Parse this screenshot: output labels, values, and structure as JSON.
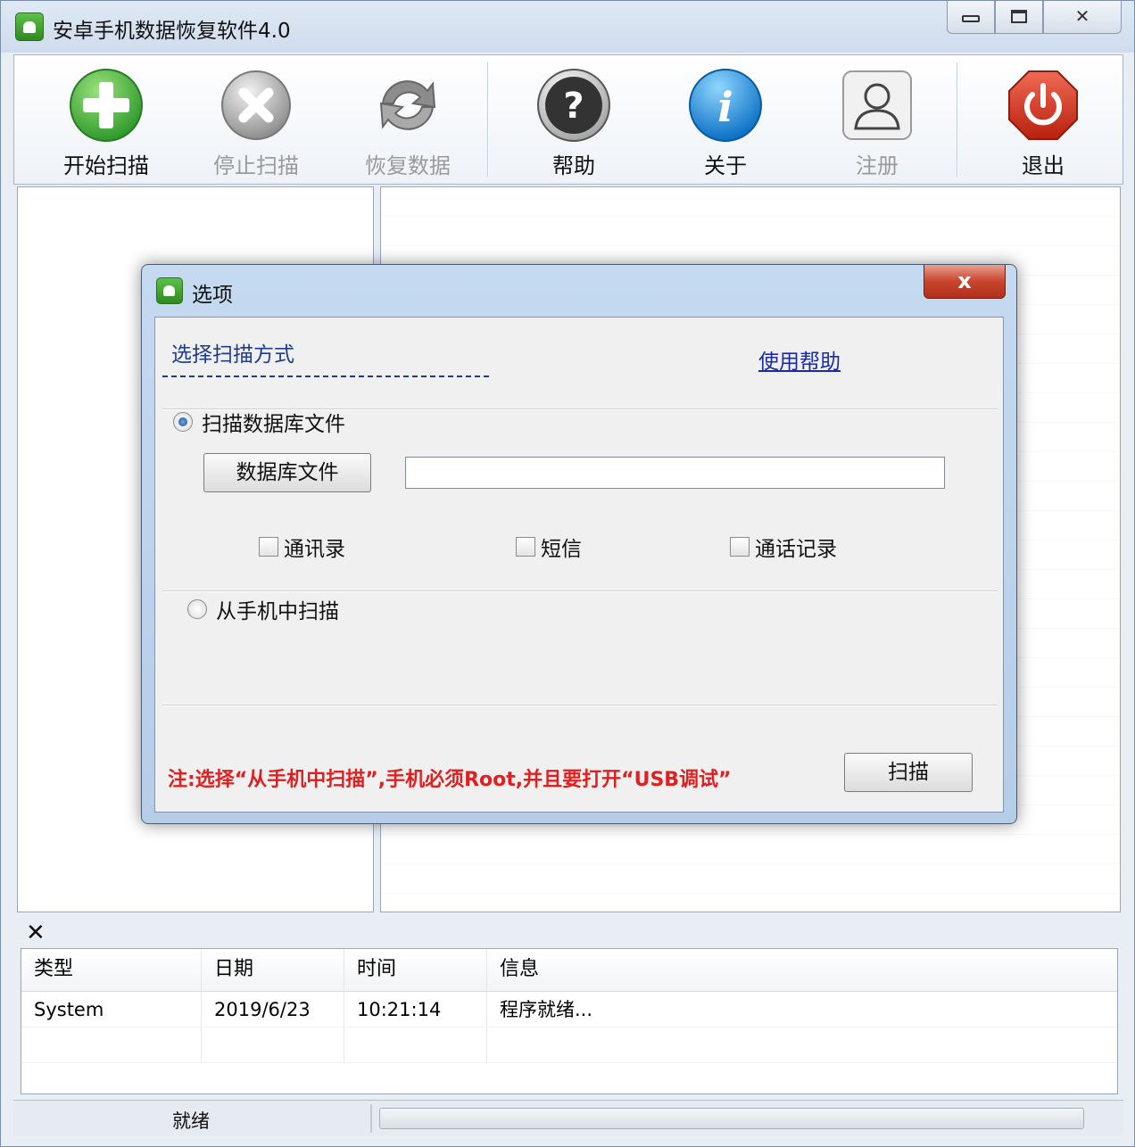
{
  "window": {
    "title": "安卓手机数据恢复软件4.0",
    "controls": {
      "minimize": "",
      "maximize": "",
      "close": "✕"
    }
  },
  "toolbar": {
    "start_scan": "开始扫描",
    "stop_scan": "停止扫描",
    "recover_data": "恢复数据",
    "help": "帮助",
    "about": "关于",
    "register": "注册",
    "exit": "退出",
    "help_glyph": "?",
    "about_glyph": "i",
    "disabled_items": [
      "停止扫描",
      "恢复数据",
      "注册"
    ]
  },
  "log": {
    "close_glyph": "✕",
    "columns": [
      "类型",
      "日期",
      "时间",
      "信息"
    ],
    "rows": [
      {
        "type": "System",
        "date": "2019/6/23",
        "time": "10:21:14",
        "info": "程序就绪..."
      }
    ]
  },
  "status": {
    "text": "就绪"
  },
  "dialog": {
    "title": "选项",
    "close_glyph": "x",
    "section_title": "选择扫描方式",
    "help_link": "使用帮助",
    "option_db": "扫描数据库文件",
    "db_button": "数据库文件",
    "db_path_value": "",
    "checkboxes": [
      "通讯录",
      "短信",
      "通话记录"
    ],
    "option_phone": "从手机中扫描",
    "selected_option": "扫描数据库文件",
    "note": "注:选择“从手机中扫描”,手机必须Root,并且要打开“USB调试”",
    "scan_button": "扫描"
  },
  "colors": {
    "title_link_blue": "#1e3c8c",
    "note_red": "#e02020",
    "start_green": "#3aa83a",
    "about_blue": "#1a8ee0",
    "exit_red": "#d63a2a"
  }
}
